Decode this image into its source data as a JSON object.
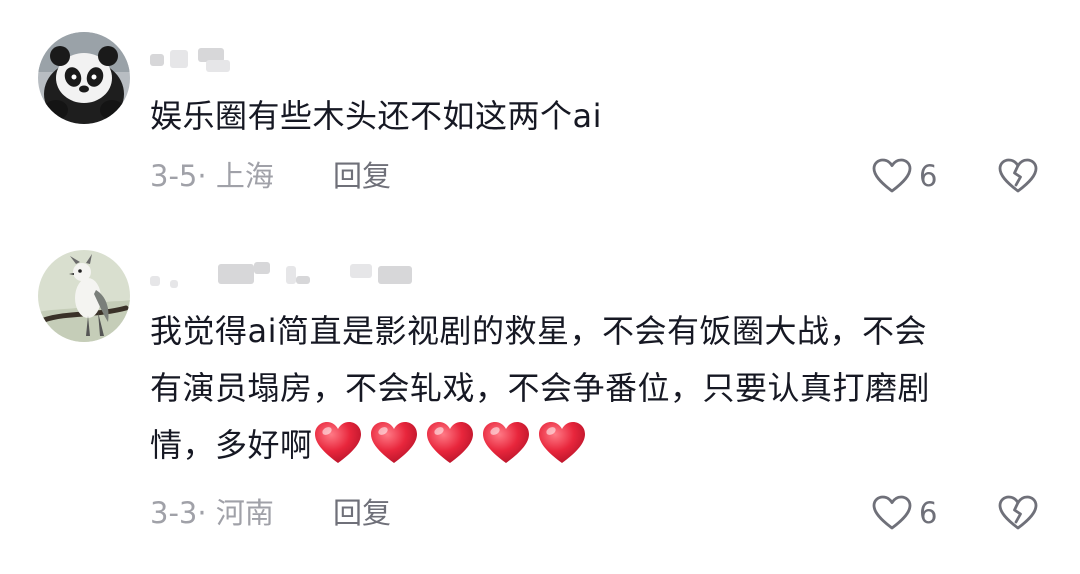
{
  "comments": [
    {
      "text": "娱乐圈有些木头还不如这两个ai",
      "date": "3-5",
      "location": "上海",
      "reply_label": "回复",
      "like_count": "6",
      "avatar_icon": "panda-avatar-icon"
    },
    {
      "text_lines": [
        "我觉得ai简直是影视剧的救星，不会有饭圈大战，不会",
        "有演员塌房，不会轧戏，不会争番位，只要认真打磨剧",
        "情，多好啊"
      ],
      "emoji_count": 5,
      "emoji": "red-heart-icon",
      "date": "3-3",
      "location": "河南",
      "reply_label": "回复",
      "like_count": "6",
      "avatar_icon": "bird-avatar-icon"
    }
  ],
  "colors": {
    "text": "#161823",
    "meta": "#a0a1a8",
    "action": "#6f7079",
    "heart": "#e8263c"
  }
}
